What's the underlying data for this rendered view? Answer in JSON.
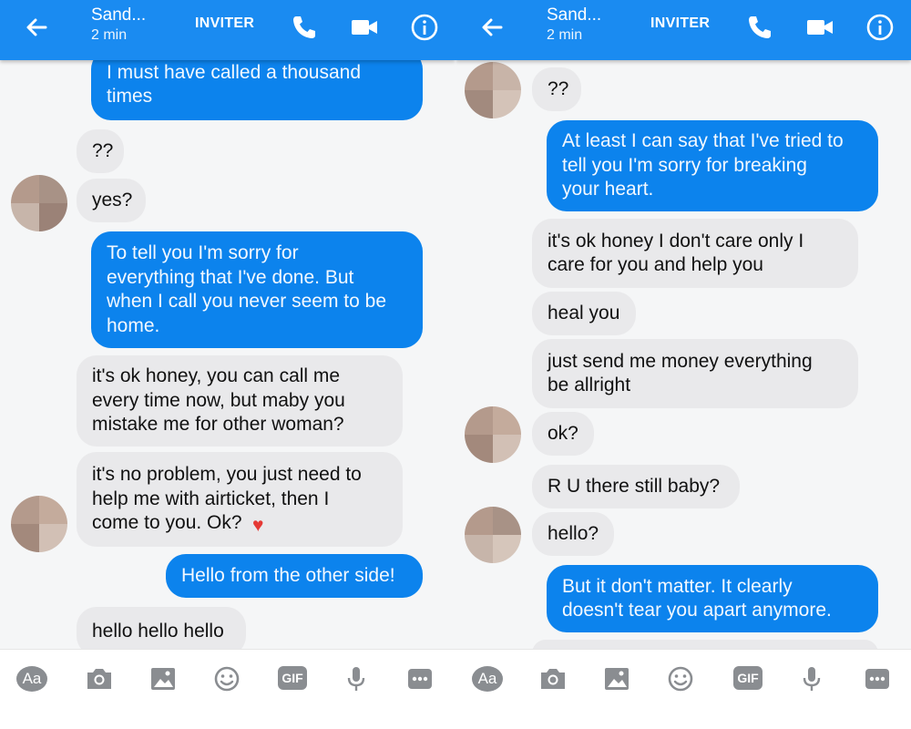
{
  "header": {
    "contact_name": "Sand...",
    "status": "2 min",
    "invite_label": "INVITER",
    "icons": [
      "arrow-left-icon",
      "phone-icon",
      "video-camera-icon",
      "info-icon"
    ]
  },
  "composer": {
    "aa_label": "Aa",
    "gif_label": "GIF",
    "icons": [
      "camera-icon",
      "image-icon",
      "smiley-icon",
      "microphone-icon",
      "more-icon"
    ]
  },
  "colors": {
    "header_bg": "#1a8bf1",
    "outgoing_bubble": "#0c83ed",
    "incoming_bubble": "#e9e9eb",
    "heart": "#e53935"
  },
  "left_messages": [
    {
      "dir": "out",
      "text": "I must have called a thousand\ntimes"
    },
    {
      "dir": "in",
      "text": "??"
    },
    {
      "dir": "in",
      "text": "yes?"
    },
    {
      "dir": "out",
      "text": "To tell you I'm sorry for\neverything that I've done. But\nwhen I call you never seem to be\nhome."
    },
    {
      "dir": "in",
      "text": "it's ok honey, you can call me\nevery time now, but maby you\nmistake me for other woman?"
    },
    {
      "dir": "in",
      "text": "it's no problem, you just need to\nhelp me with airticket, then I\ncome to you. Ok? ",
      "heart": "♥"
    },
    {
      "dir": "out",
      "text": "Hello from the other side!"
    },
    {
      "dir": "in",
      "text": "hello hello hello"
    }
  ],
  "right_messages": [
    {
      "dir": "in",
      "text": "??"
    },
    {
      "dir": "out",
      "text": "At least I can say that I've tried to\ntell you I'm sorry for breaking\nyour heart."
    },
    {
      "dir": "in",
      "text": "it's ok honey I don't care only I\ncare for you and help you"
    },
    {
      "dir": "in",
      "text": "heal you"
    },
    {
      "dir": "in",
      "text": "just send me money everything\nbe allright"
    },
    {
      "dir": "in",
      "text": "ok?"
    },
    {
      "dir": "in",
      "text": "R U there still baby?"
    },
    {
      "dir": "in",
      "text": "hello?"
    },
    {
      "dir": "out",
      "text": "But it don't matter. It clearly\ndoesn't tear you apart anymore."
    }
  ]
}
